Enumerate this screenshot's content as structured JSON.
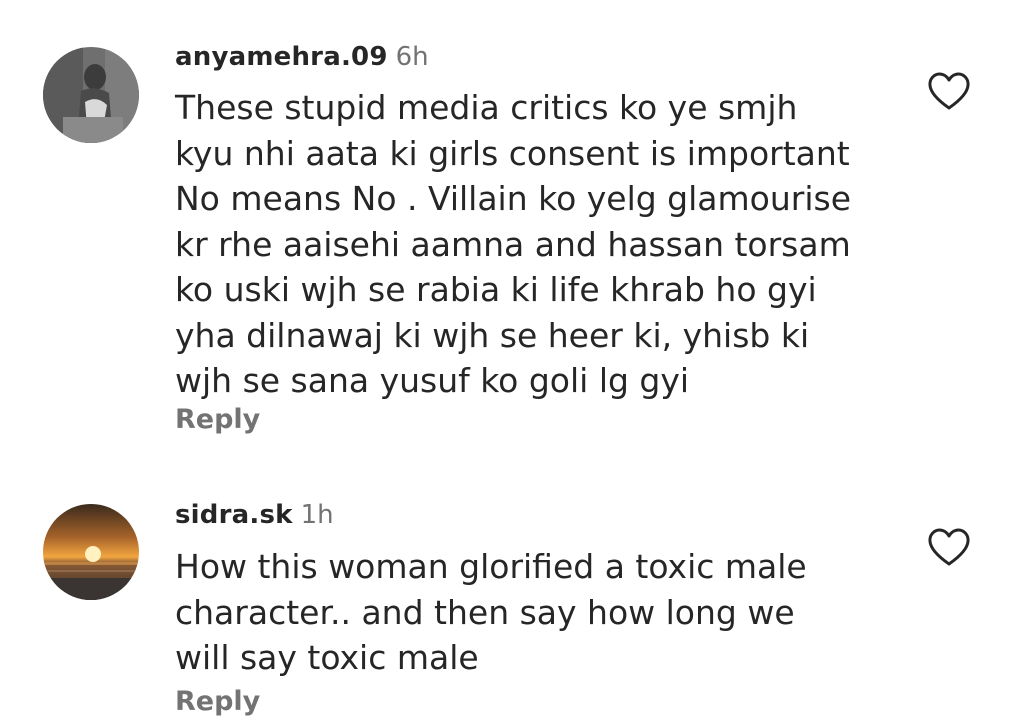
{
  "comments": [
    {
      "username": "anyamehra.09",
      "time": "6h",
      "text": "These stupid media critics ko ye smjh\nkyu nhi aata ki girls consent is important\nNo means No . Villain ko yelg glamourise\nkr rhe aaisehi aamna and hassan torsam\nko uski wjh se rabia ki life khrab ho gyi\nyha dilnawaj ki wjh se heer ki, yhisb ki\nwjh se sana yusuf ko goli lg gyi",
      "reply_label": "Reply",
      "like_icon": "heart-outline-icon",
      "avatar_icon": "profile-photo-girl"
    },
    {
      "username": "sidra.sk",
      "time": "1h",
      "text": "How this woman glorified a toxic male\ncharacter.. and then say how long we\nwill say toxic male",
      "reply_label": "Reply",
      "like_icon": "heart-outline-icon",
      "avatar_icon": "profile-photo-sunset"
    }
  ],
  "colors": {
    "text": "#262626",
    "secondary": "#737373",
    "background": "#ffffff"
  }
}
